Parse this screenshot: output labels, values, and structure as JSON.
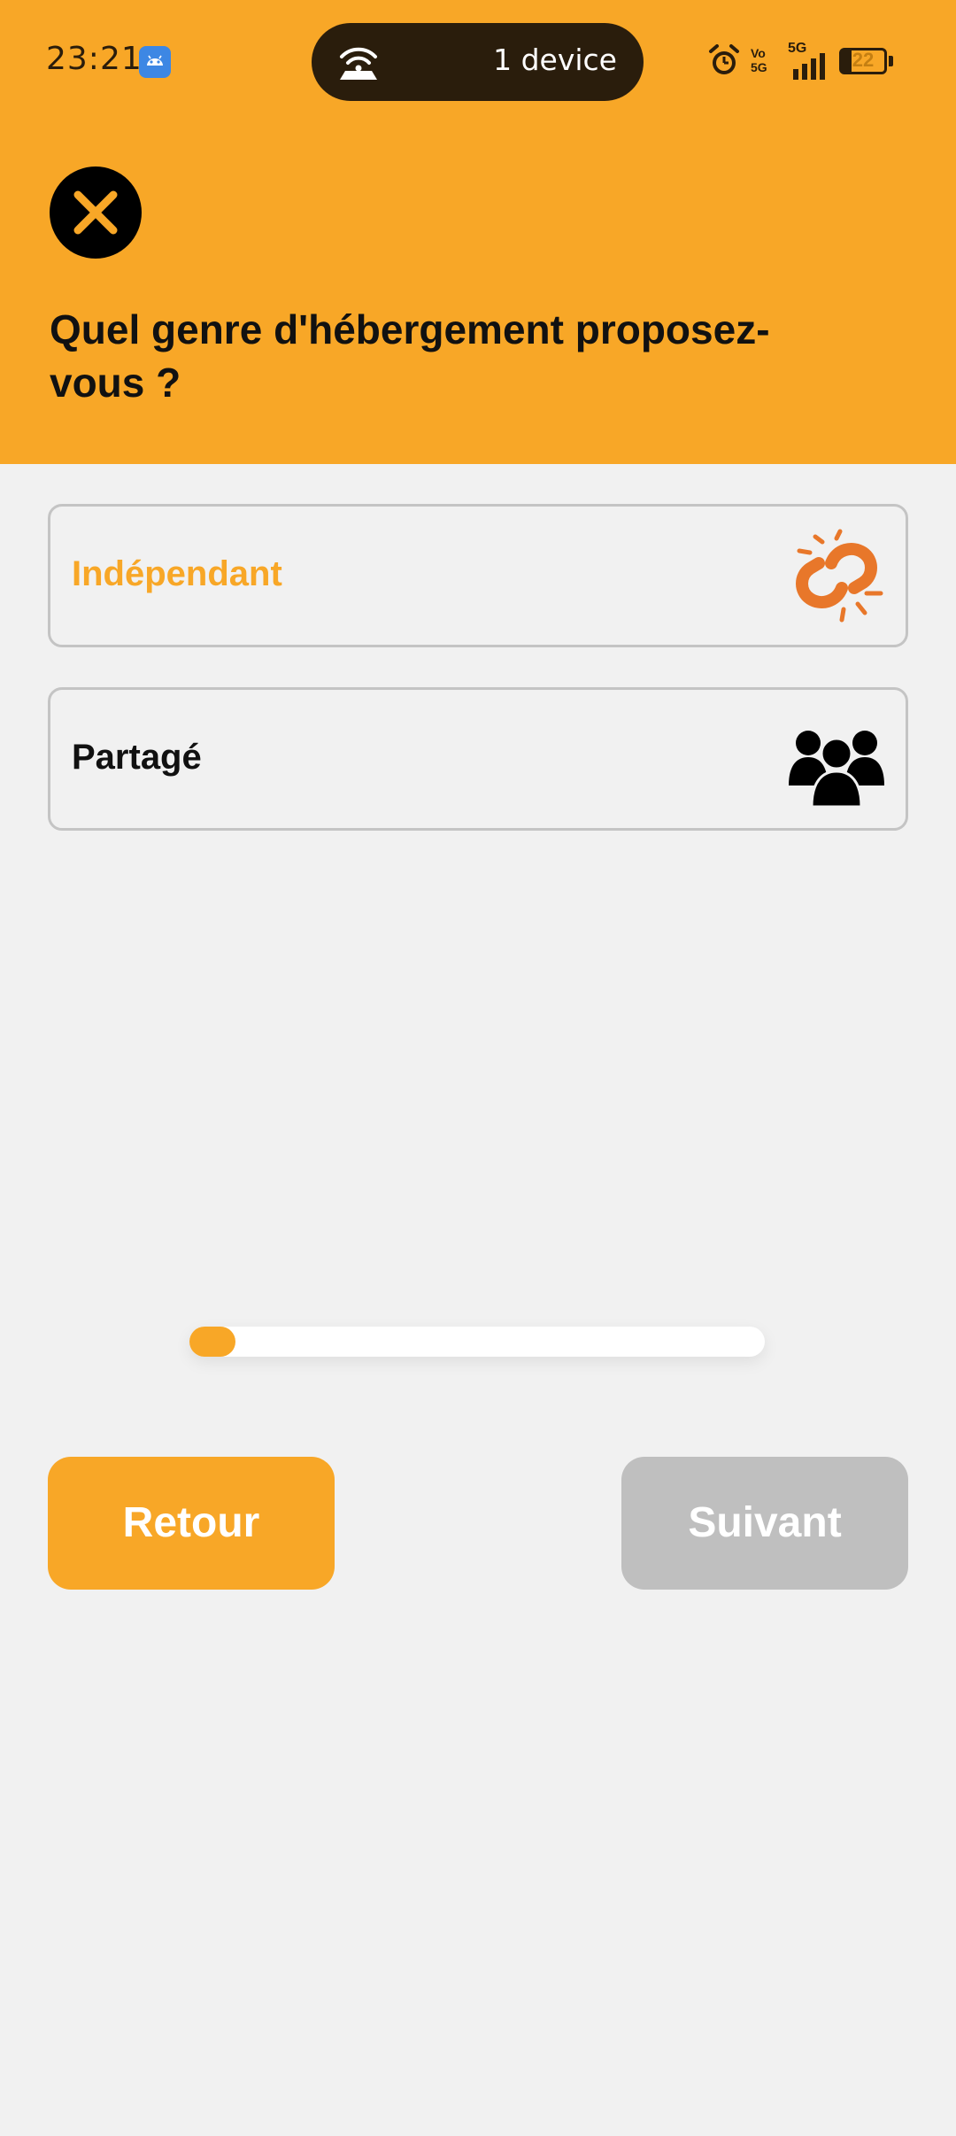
{
  "status_bar": {
    "time": "23:21",
    "island_text": "1 device",
    "battery_level": "22",
    "icons": [
      "android-icon",
      "hotspot-icon",
      "alarm-icon",
      "volte-icon",
      "5g-signal-icon",
      "battery-icon"
    ],
    "volte_label": "Vo 5G",
    "network_label": "5G"
  },
  "header": {
    "title": "Quel genre d'hébergement proposez-vous ?",
    "close_icon": "close-icon"
  },
  "options": [
    {
      "label": "Indépendant",
      "icon": "linked-chain-icon",
      "selected": true,
      "label_color": "#f8a727"
    },
    {
      "label": "Partagé",
      "icon": "people-group-icon",
      "selected": false,
      "label_color": "#111111"
    }
  ],
  "progress": {
    "value": 0.08
  },
  "buttons": {
    "back_label": "Retour",
    "next_label": "Suivant",
    "next_enabled": false
  },
  "colors": {
    "accent": "#f8a727",
    "background": "#f1f1f1",
    "disabled": "#bfbfbf",
    "icon_orange": "#e8772a"
  }
}
